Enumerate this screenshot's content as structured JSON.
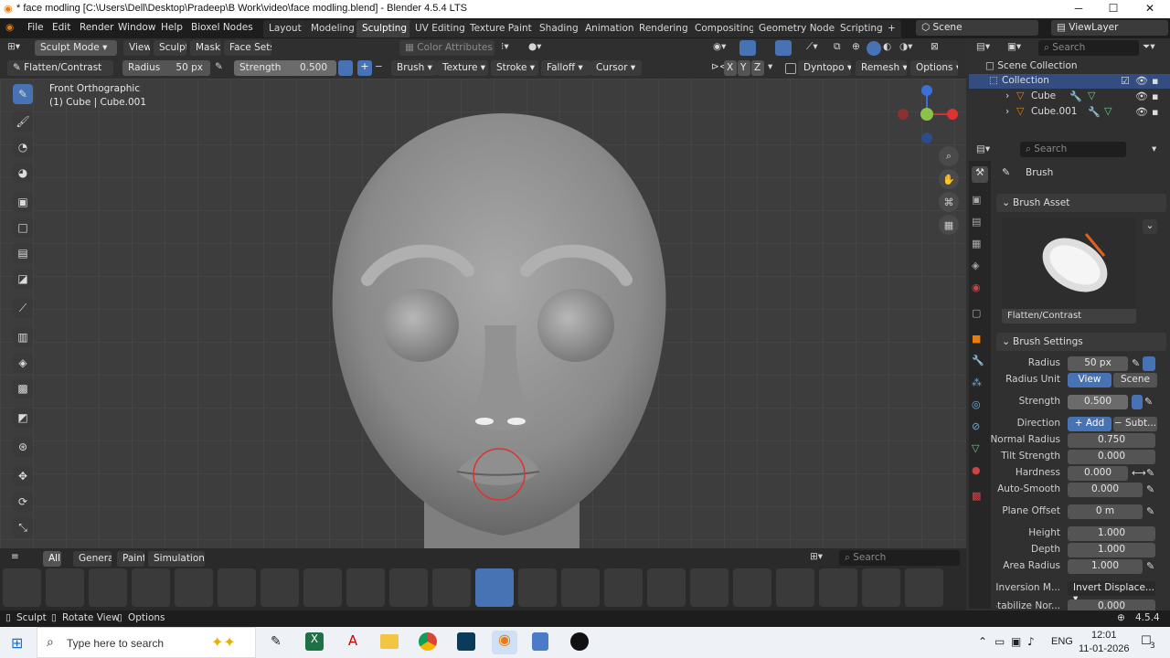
{
  "window": {
    "title": "* face modling [C:\\Users\\Dell\\Desktop\\Pradeep\\B Work\\video\\face modling.blend] - Blender 4.5.4 LTS",
    "minimize": "─",
    "maximize": "☐",
    "close": "✕"
  },
  "menu": [
    "File",
    "Edit",
    "Render",
    "Window",
    "Help",
    "Bioxel Nodes"
  ],
  "workspaces": [
    "Layout",
    "Modeling",
    "Sculpting",
    "UV Editing",
    "Texture Paint",
    "Shading",
    "Animation",
    "Rendering",
    "Compositing",
    "Geometry Nodes",
    "Scripting"
  ],
  "active_workspace": "Sculpting",
  "scene": "Scene",
  "view_layer": "ViewLayer",
  "header": {
    "mode": "Sculpt Mode",
    "view": "View",
    "sculpt": "Sculpt",
    "mask": "Mask",
    "face_sets": "Face Sets",
    "color_attributes": "Color Attributes"
  },
  "tool_settings": {
    "brush": "Flatten/Contrast",
    "radius_label": "Radius",
    "radius": "50 px",
    "strength_label": "Strength",
    "strength": "0.500",
    "brush_menu": "Brush",
    "texture": "Texture",
    "stroke": "Stroke",
    "falloff": "Falloff",
    "cursor": "Cursor",
    "x": "X",
    "y": "Y",
    "z": "Z",
    "dyntopo": "Dyntopo",
    "remesh": "Remesh",
    "options": "Options"
  },
  "viewport": {
    "view_name": "Front Orthographic",
    "object_info": "(1) Cube | Cube.001"
  },
  "shelf_tabs": [
    "All",
    "General",
    "Paint",
    "Simulation"
  ],
  "shelf_search_placeholder": "Search",
  "outliner": {
    "search_placeholder": "Search",
    "root": "Scene Collection",
    "collection": "Collection",
    "objects": [
      "Cube",
      "Cube.001"
    ]
  },
  "properties": {
    "search_placeholder": "Search",
    "context": "Brush",
    "brush_asset_title": "Brush Asset",
    "brush_asset_name": "Flatten/Contrast",
    "brush_settings_title": "Brush Settings",
    "rows": [
      {
        "label": "Radius",
        "value": "50 px"
      },
      {
        "label": "Radius Unit",
        "value": "View",
        "value2": "Scene"
      },
      {
        "label": "Strength",
        "value": "0.500"
      },
      {
        "label": "Direction",
        "value": "Add",
        "value2": "Subt..."
      },
      {
        "label": "Normal Radius",
        "value": "0.750"
      },
      {
        "label": "Tilt Strength",
        "value": "0.000"
      },
      {
        "label": "Hardness",
        "value": "0.000"
      },
      {
        "label": "Auto-Smooth",
        "value": "0.000"
      },
      {
        "label": "Plane Offset",
        "value": "0 m"
      },
      {
        "label": "Height",
        "value": "1.000"
      },
      {
        "label": "Depth",
        "value": "1.000"
      },
      {
        "label": "Area Radius",
        "value": "1.000"
      },
      {
        "label": "Inversion M...",
        "value": "Invert Displace..."
      },
      {
        "label": "Stabilize Nor...",
        "value": "0.000"
      }
    ]
  },
  "status": {
    "sculpt": "Sculpt",
    "rotate": "Rotate View",
    "options": "Options",
    "version": "4.5.4"
  },
  "taskbar": {
    "search_placeholder": "Type here to search",
    "lang": "ENG",
    "time": "12:01",
    "date": "11-01-2026",
    "notif": "3"
  }
}
